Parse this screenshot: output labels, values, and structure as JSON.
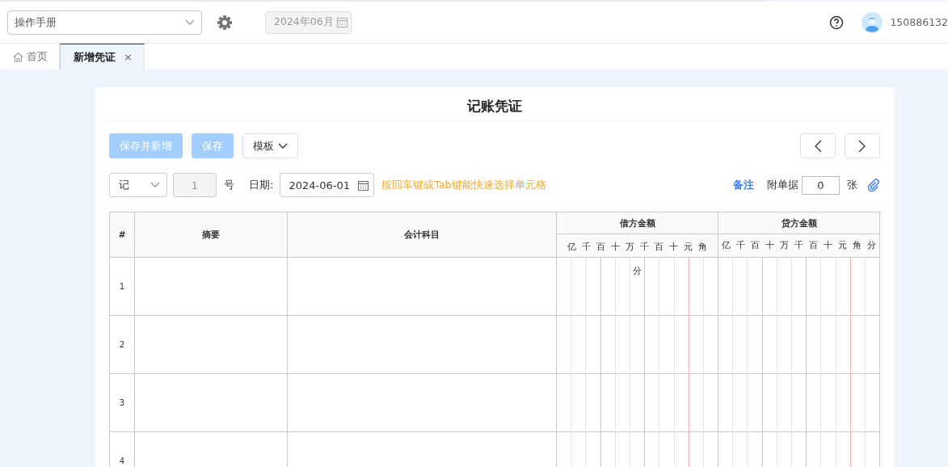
{
  "toolbar": {
    "book_select": {
      "value": "操作手册"
    },
    "period_field": {
      "value": "2024年06月",
      "disabled": true
    },
    "user": {
      "name": "150886132"
    }
  },
  "tabs": [
    {
      "label": "首页",
      "selected": false,
      "kind": "home"
    },
    {
      "label": "新增凭证",
      "selected": true,
      "kind": "closable",
      "close": "×"
    }
  ],
  "voucher": {
    "title": "记账凭证",
    "buttons": [
      {
        "label": "保存并新增",
        "kind": "primary",
        "disabled": true
      },
      {
        "label": "保存",
        "kind": "primary",
        "disabled": true
      },
      {
        "label": "模板",
        "kind": "dropdown",
        "disabled": false
      }
    ],
    "word_select": {
      "value": "记"
    },
    "number_field": {
      "value": "1",
      "disabled": true
    },
    "number_suffix": "号",
    "date_label": "日期:",
    "date_field": {
      "value": "2024-06-01"
    },
    "hint": "按回车键或Tab键能快速选择单元格",
    "note_link": "备注",
    "attach_label": "附单据",
    "attach_field": {
      "value": "0"
    },
    "attach_unit": "张"
  },
  "table": {
    "columns": [
      "#",
      "摘要",
      "会计科目"
    ],
    "debit": {
      "label": "借方金额",
      "units": [
        "亿",
        "千",
        "百",
        "十",
        "万",
        "千",
        "百",
        "十",
        "元",
        "角",
        "分"
      ]
    },
    "credit": {
      "label": "贷方金额",
      "units": [
        "亿",
        "千",
        "百",
        "十",
        "万",
        "千",
        "百",
        "十",
        "元",
        "角",
        "分"
      ]
    },
    "rows": [
      {
        "number": "1"
      },
      {
        "number": "2"
      },
      {
        "number": "3"
      },
      {
        "number": "4"
      }
    ]
  }
}
